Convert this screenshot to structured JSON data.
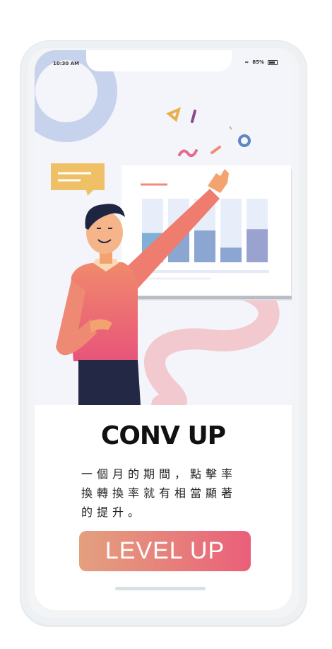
{
  "status_bar": {
    "time": "10:30 AM",
    "battery": "85%"
  },
  "hero": {
    "title": "CONV UP"
  },
  "description_lines": [
    "一個月的期間，點擊率",
    "換轉換率就有相當顯著",
    "的提升。"
  ],
  "cta": {
    "label": "LEVEL UP"
  },
  "chart_data": {
    "type": "bar",
    "categories": [
      "",
      "",
      "",
      "",
      ""
    ],
    "values": [
      0.46,
      0.48,
      0.5,
      0.23,
      0.52
    ],
    "ylim": [
      0,
      1
    ]
  },
  "colors": {
    "accent_start": "#e4a07e",
    "accent_end": "#ea5f7a",
    "shirt": "#ef7d6f",
    "bars": "#8aa6d1"
  }
}
